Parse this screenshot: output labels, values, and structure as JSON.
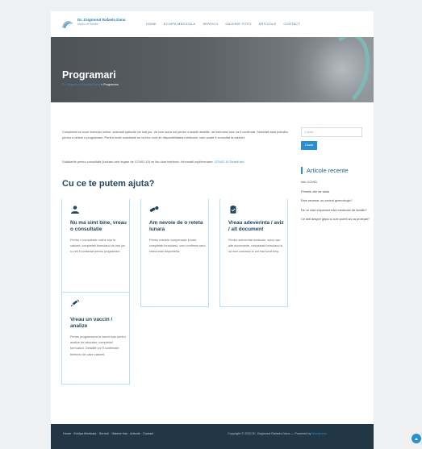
{
  "header": {
    "logo_name": "Dr. Zsigmond Rafaela Dana",
    "logo_sub": "Medic de familie",
    "nav": [
      "HOME",
      "ECHIPA MEDICALA",
      "SERVICII",
      "GALERIE FOTO",
      "ARTICOLE",
      "CONTACT"
    ]
  },
  "banner": {
    "title": "Programari",
    "breadcrumb_home": "Dr. Zsigmond Rafaela Dana",
    "breadcrumb_sep": "»",
    "breadcrumb_current": "Programari"
  },
  "main": {
    "intro": "Completati un scurt formular online, selectati optiunile de mai jos. Va vom suna noi pentru a stabili detaliile, iar intervalul orar va fi confirmat. Selectati data potrivita pentru a obtine o programare. Pentru toate solicitarile se va tine cont de disponibilitatea medicului, care poate fi consultat la cabinet.",
    "intro2_text": "Solicitarile pentru consultatii (inclusiv cele legate de COVID-19) se fac doar telefonic. Informatii suplimentare:",
    "intro2_link": "COVID-19 Detalii aici",
    "section_heading": "Cu ce te putem ajuta?",
    "cards": [
      {
        "title": "Nu ma simt bine, vreau o consultatie",
        "text": "Pentru o consultatie online sau la cabinet, completati formularul de mai jos si veti fi contactat pentru programare."
      },
      {
        "title": "Am nevoie de o reteta lunara",
        "text": "Pentru retetele compensate lunare, completati formularul, vom confirma cand reteta este disponibila."
      },
      {
        "title": "Vreau adeverinta / aviz / alt document",
        "text": "Pentru adeverinte medicale, avize sau alte documente, completati formularul si va vom contacta in cel mai scurt timp."
      },
      {
        "title": "Vreau un vaccin / analize",
        "text": "Pentru programarea la vaccin sau pentru analize de laborator, completati formularul. Detaliile vor fi confirmate telefonic de catre cabinet."
      }
    ]
  },
  "sidebar": {
    "search_placeholder": "Cauta ...",
    "search_button": "Cauta",
    "recent_heading": "Articole recente",
    "recent": [
      "Info COVID",
      "Primele zile de viata",
      "Este necesar un control ginecologic?",
      "De ce este important rolul medicului de familie?",
      "Ce stiti despre gripa si cum puteti sa va protejati?"
    ]
  },
  "footer": {
    "nav_text": "Home · Echipa Medicala · Servicii · Galerie foto · Articole · Contact",
    "copyright": "Copyright © 2020 Dr. Zsigmond Rafaela Dana — Powered by",
    "powered_link": "Wordpress"
  },
  "colors": {
    "accent": "#2a8fd1",
    "heading": "#1f4560",
    "footer": "#223746"
  }
}
